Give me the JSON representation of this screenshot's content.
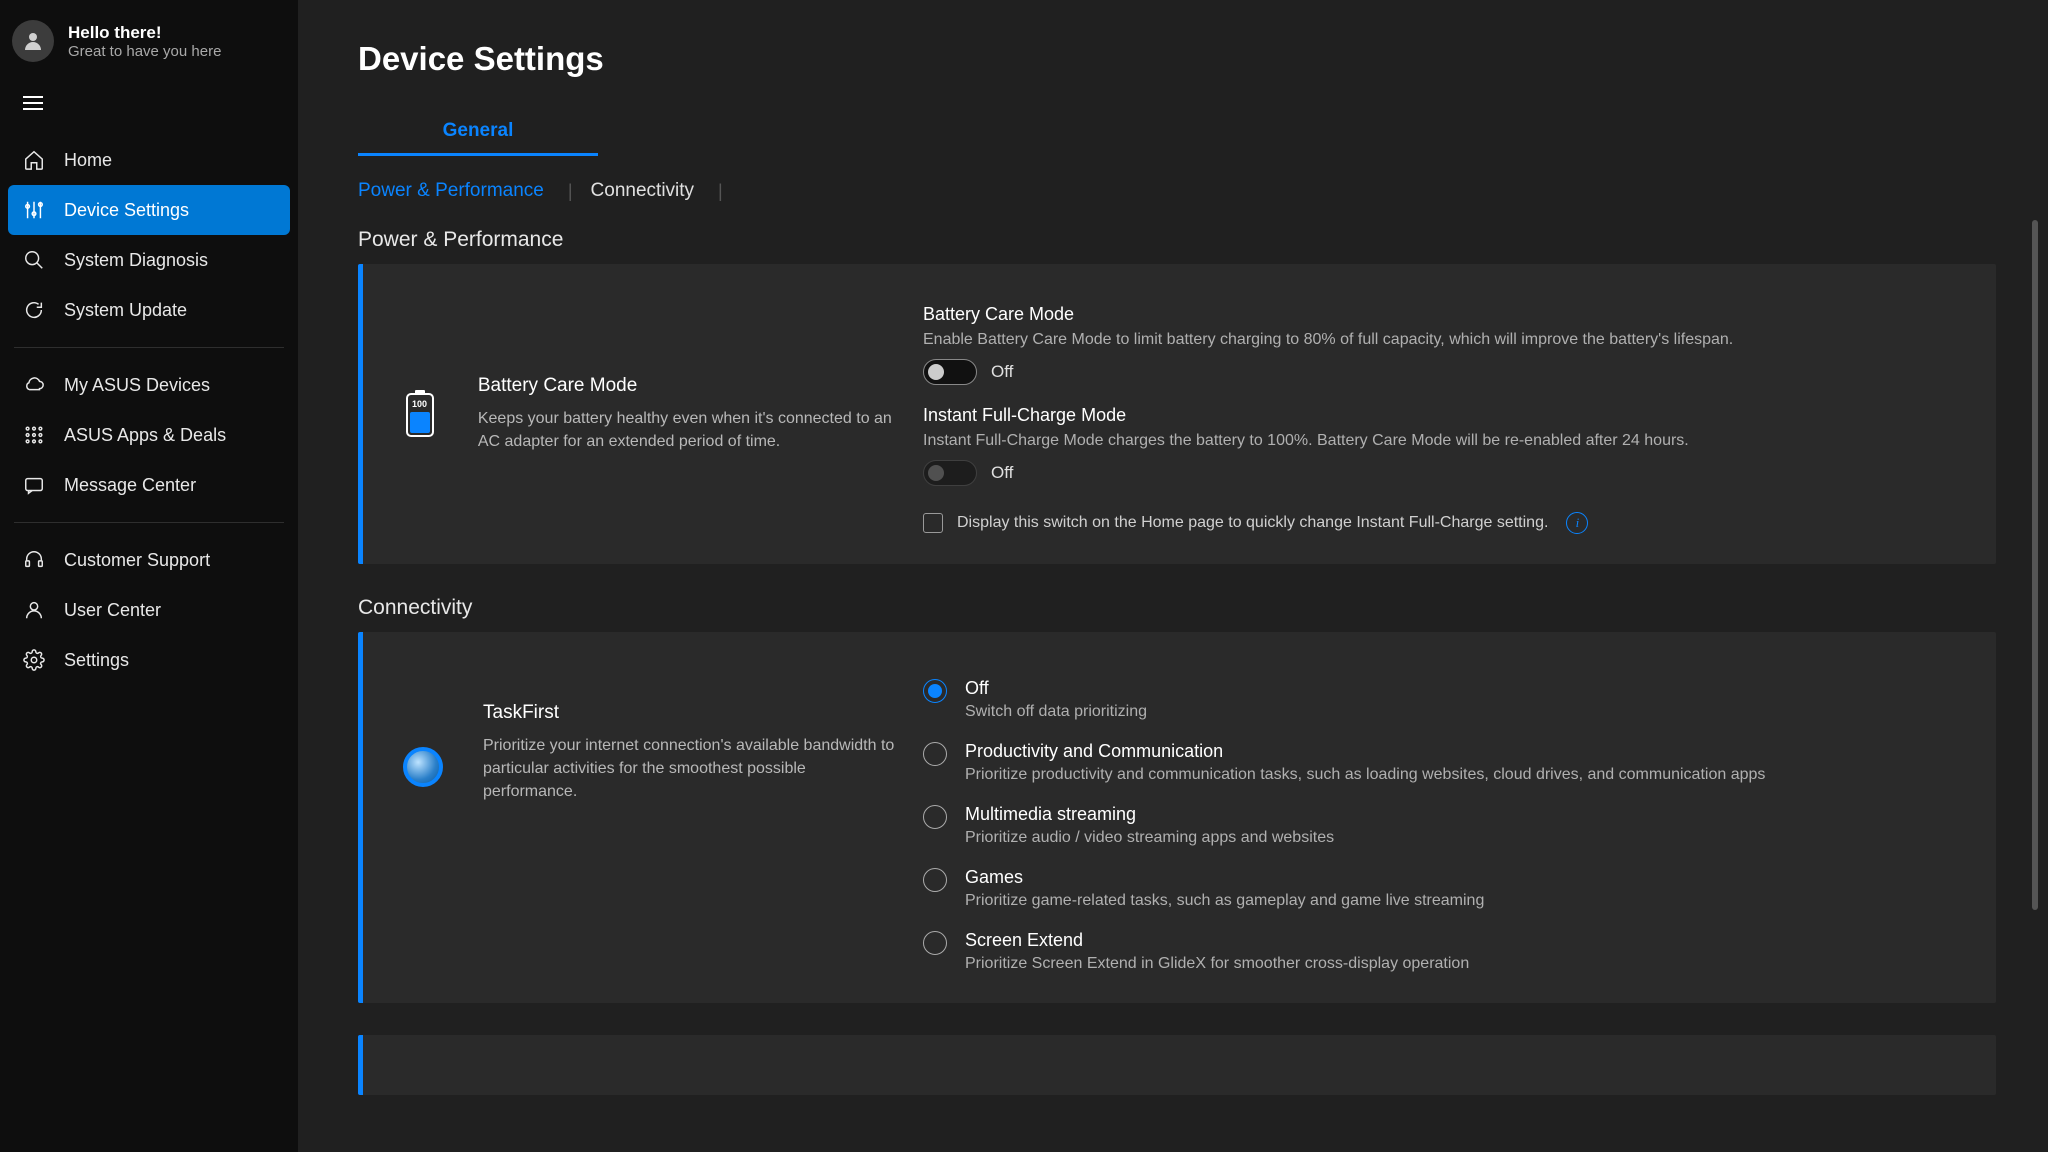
{
  "user": {
    "greeting": "Hello there!",
    "subtext": "Great to have you here"
  },
  "nav": {
    "home": "Home",
    "device_settings": "Device Settings",
    "system_diagnosis": "System Diagnosis",
    "system_update": "System Update",
    "my_asus_devices": "My ASUS Devices",
    "asus_apps_deals": "ASUS Apps & Deals",
    "message_center": "Message Center",
    "customer_support": "Customer Support",
    "user_center": "User Center",
    "settings": "Settings"
  },
  "page": {
    "title": "Device Settings",
    "tab_general": "General",
    "subtab_power": "Power & Performance",
    "subtab_conn": "Connectivity"
  },
  "sections": {
    "power_perf": "Power & Performance",
    "connectivity": "Connectivity"
  },
  "battery": {
    "icon_label": "100",
    "feature_title": "Battery Care Mode",
    "feature_desc": "Keeps your battery healthy even when it's connected to an AC adapter for an extended period of time.",
    "care_title": "Battery Care Mode",
    "care_desc": "Enable Battery Care Mode to limit battery charging to 80% of full capacity, which will improve the battery's lifespan.",
    "care_state": "Off",
    "full_title": "Instant Full-Charge Mode",
    "full_desc": "Instant Full-Charge Mode charges the battery to 100%. Battery Care Mode will be re-enabled after 24 hours.",
    "full_state": "Off",
    "home_switch_label": "Display this switch on the Home page to quickly change Instant Full-Charge setting."
  },
  "taskfirst": {
    "title": "TaskFirst",
    "desc": "Prioritize your internet connection's available bandwidth to particular activities for the smoothest possible performance.",
    "options": {
      "off": {
        "label": "Off",
        "desc": "Switch off data prioritizing"
      },
      "prod": {
        "label": "Productivity and Communication",
        "desc": "Prioritize productivity and communication tasks, such as loading websites, cloud drives, and communication apps"
      },
      "multi": {
        "label": "Multimedia streaming",
        "desc": "Prioritize audio / video streaming apps and websites"
      },
      "games": {
        "label": "Games",
        "desc": "Prioritize game-related tasks, such as gameplay and game live streaming"
      },
      "screen": {
        "label": "Screen Extend",
        "desc": "Prioritize Screen Extend in GlideX for smoother cross-display operation"
      }
    }
  }
}
